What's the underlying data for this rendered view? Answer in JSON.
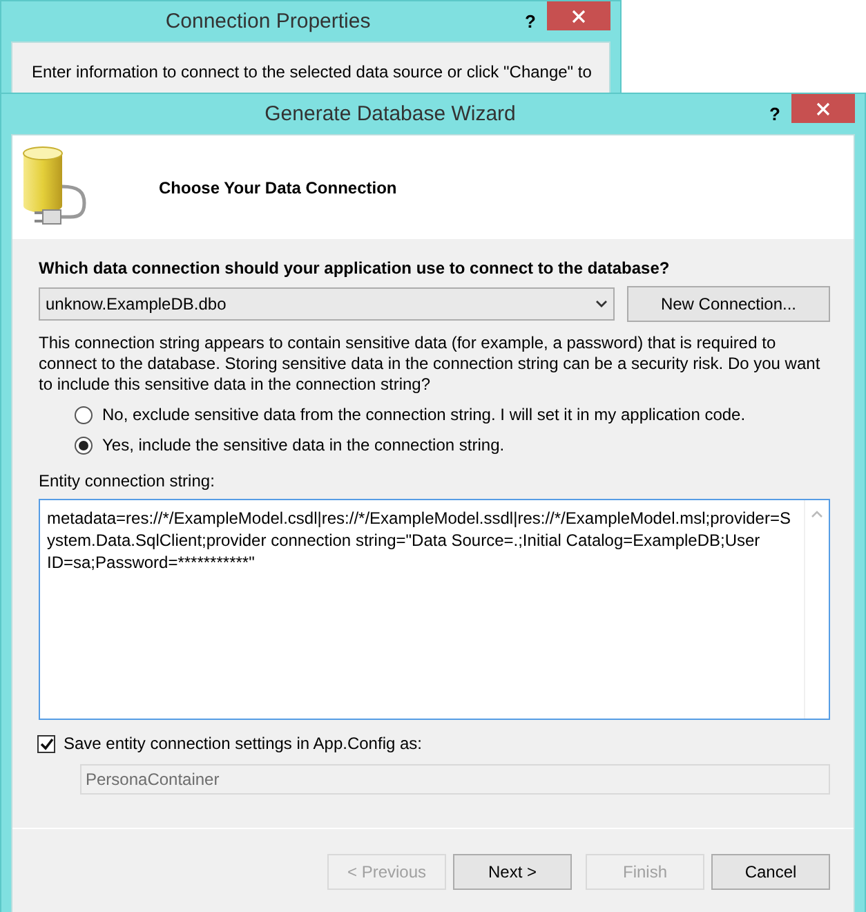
{
  "background_window": {
    "title": "Connection Properties",
    "help_label": "?",
    "text": "Enter information to connect to the selected data source or click \"Change\" to"
  },
  "wizard": {
    "title": "Generate Database Wizard",
    "help_label": "?",
    "header": "Choose Your Data Connection",
    "question": {
      "text": "Which data connection should your application use to connect to the database?"
    },
    "connection_dropdown": {
      "value": "unknow.ExampleDB.dbo"
    },
    "new_connection_button": {
      "label": "New Connection..."
    },
    "warning": "This connection string appears to contain sensitive data (for example, a password) that is required to connect to the database. Storing sensitive data in the connection string can be a security risk. Do you want to include this sensitive data in the connection string?",
    "sensitive_options": [
      {
        "label": "No, exclude sensitive data from the connection string. I will set it in my application code.",
        "selected": false
      },
      {
        "label": "Yes, include the sensitive data in the connection string.",
        "selected": true
      }
    ],
    "connection_string_label": "Entity connection string:",
    "connection_string": "metadata=res://*/ExampleModel.csdl|res://*/ExampleModel.ssdl|res://*/ExampleModel.msl;provider=System.Data.SqlClient;provider connection string=\"Data Source=.;Initial Catalog=ExampleDB;User ID=sa;Password=***********\"",
    "save_setting": {
      "label": "Save entity connection settings in App.Config as:",
      "checked": true
    },
    "container_name": {
      "value": "PersonaContainer",
      "disabled": true
    },
    "buttons": [
      {
        "label": "< Previous",
        "disabled": true
      },
      {
        "label": "Next >",
        "disabled": false
      },
      {
        "label": "Finish",
        "disabled": true
      },
      {
        "label": "Cancel",
        "disabled": false
      }
    ]
  }
}
